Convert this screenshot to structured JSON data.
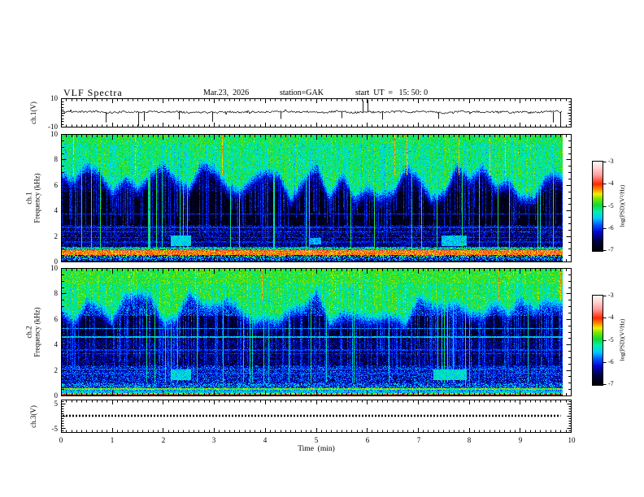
{
  "title": {
    "main": "VLF  Spectra",
    "date": "Mar.23,  2026",
    "station": "station=GAK",
    "start_ut": "start  UT  =   15: 50: 0"
  },
  "axes": {
    "x": {
      "label": "Time  (min)",
      "ticks": [
        "0",
        "1",
        "2",
        "3",
        "4",
        "5",
        "6",
        "7",
        "8",
        "9",
        "10"
      ],
      "min": 0,
      "max": 10
    },
    "ch1_wave": {
      "label": "ch.1(V)",
      "tick_top": "10",
      "tick_bottom": "-10",
      "min": -10,
      "max": 10
    },
    "ch1_freq": {
      "label_line1": "ch.1",
      "label_line2": "Frequency  (kHz)",
      "ticks": [
        "10",
        "8",
        "6",
        "4",
        "2",
        "0"
      ],
      "min": 0,
      "max": 10
    },
    "ch2_freq": {
      "label_line1": "ch.2",
      "label_line2": "Frequency  (kHz)",
      "ticks": [
        "10",
        "8",
        "6",
        "4",
        "2",
        "0"
      ],
      "min": 0,
      "max": 10
    },
    "ch3_wave": {
      "label": "ch.3(V)",
      "tick_top": "5",
      "tick_bottom": "-5",
      "min": -6.6,
      "max": 6.6
    }
  },
  "colorbar": {
    "label": "log(PSD)(V²/Hz)",
    "ticks": [
      "-3",
      "-4",
      "-5",
      "-6",
      "-7"
    ],
    "min": -7,
    "max": -3,
    "stops": [
      {
        "v": -7.0,
        "c": "#000000"
      },
      {
        "v": -6.55,
        "c": "#00004a"
      },
      {
        "v": -6.15,
        "c": "#0008d6"
      },
      {
        "v": -5.85,
        "c": "#0054ff"
      },
      {
        "v": -5.55,
        "c": "#00c8ff"
      },
      {
        "v": -5.25,
        "c": "#00f0b4"
      },
      {
        "v": -4.95,
        "c": "#10dc30"
      },
      {
        "v": -4.65,
        "c": "#7ce800"
      },
      {
        "v": -4.45,
        "c": "#f0f000"
      },
      {
        "v": -4.25,
        "c": "#ff9000"
      },
      {
        "v": -4.0,
        "c": "#ff2800"
      },
      {
        "v": -3.6,
        "c": "#ff9c9c"
      },
      {
        "v": -3.25,
        "c": "#ffd8d8"
      },
      {
        "v": -3.0,
        "c": "#fff2f2"
      }
    ]
  },
  "chart_data": [
    {
      "panel": "ch1_waveform",
      "type": "line",
      "x_range": [
        0,
        10
      ],
      "y_range": [
        -10,
        10
      ],
      "baseline": 0.35,
      "noise_amp": 1.4,
      "data_end_t": 9.84,
      "seed": 11,
      "spikes": [
        {
          "t": 0.88,
          "v": -7
        },
        {
          "t": 1.52,
          "v": -9.5
        },
        {
          "t": 1.62,
          "v": -6
        },
        {
          "t": 2.32,
          "v": -5
        },
        {
          "t": 2.96,
          "v": -6.5
        },
        {
          "t": 4.3,
          "v": -4.5
        },
        {
          "t": 5.5,
          "v": -4
        },
        {
          "t": 5.92,
          "v": 8.5
        },
        {
          "t": 6.02,
          "v": 9
        },
        {
          "t": 6.3,
          "v": -5
        },
        {
          "t": 7.4,
          "v": -4.5
        },
        {
          "t": 9.65,
          "v": -7
        },
        {
          "t": 9.8,
          "v": -9
        }
      ]
    },
    {
      "panel": "ch1_spectrogram",
      "type": "heatmap",
      "x_range": [
        0,
        10
      ],
      "f_range": [
        0,
        10
      ],
      "level_range": [
        -7,
        -3
      ],
      "data_end_t": 9.84,
      "seed": 42,
      "speckle": 0.22,
      "top": {
        "depth_base": 7.0,
        "depth_var": 1.6,
        "level": -5.15,
        "ramp": 1.5
      },
      "bands": [
        {
          "f0": 9.3,
          "f1": 10,
          "level": -5.1,
          "noise": 0.3
        },
        {
          "f0": 7.0,
          "f1": 9.3,
          "level": -6.1,
          "noise": 0.6
        },
        {
          "f0": 5.5,
          "f1": 7.0,
          "level": -6.6,
          "noise": 0.4
        },
        {
          "f0": 2.9,
          "f1": 5.5,
          "level": -6.85,
          "noise": 0.28
        },
        {
          "f0": 1.15,
          "f1": 2.9,
          "level": -6.45,
          "noise": 0.5
        },
        {
          "f0": 0.95,
          "f1": 1.15,
          "level": -5.7,
          "noise": 0.4
        },
        {
          "f0": 0.55,
          "f1": 0.95,
          "level": -4.15,
          "noise": 0.35
        },
        {
          "f0": 0.32,
          "f1": 0.55,
          "level": -5.8,
          "noise": 1.3
        },
        {
          "f0": 0.1,
          "f1": 0.32,
          "level": -5.9,
          "noise": 0.6
        },
        {
          "f0": 0.0,
          "f1": 0.1,
          "level": -6.9,
          "noise": 0.15
        }
      ],
      "hlines": [
        {
          "f": 3.75,
          "level": -6.05
        },
        {
          "f": 2.7,
          "level": -6.0
        },
        {
          "f": 2.35,
          "level": -6.0
        },
        {
          "f": 1.9,
          "level": -6.1
        },
        {
          "f": 1.55,
          "level": -6.1
        },
        {
          "f": 1.02,
          "level": -5.0
        }
      ],
      "patches": [
        {
          "t0": 2.15,
          "t1": 2.55,
          "f0": 1.25,
          "f1": 2.1,
          "level": -5.45
        },
        {
          "t0": 7.45,
          "t1": 7.95,
          "f0": 1.25,
          "f1": 2.05,
          "level": -5.5
        },
        {
          "t0": 4.85,
          "t1": 5.1,
          "f0": 1.35,
          "f1": 1.9,
          "level": -5.6
        }
      ],
      "streaks": {
        "strong_prob": 0.055,
        "strong_level": -5.25,
        "med_prob": 0.3,
        "med_level": -6.1,
        "med_min_f": 2.8,
        "orange_prob": 0.02,
        "orange_level": -4.35,
        "orange_min_f": 6.8
      }
    },
    {
      "panel": "ch2_spectrogram",
      "type": "heatmap",
      "x_range": [
        0,
        10
      ],
      "f_range": [
        0,
        10
      ],
      "level_range": [
        -7,
        -3
      ],
      "data_end_t": 9.84,
      "seed": 77,
      "speckle": 0.22,
      "top": {
        "depth_base": 7.5,
        "depth_var": 1.3,
        "level": -5.05,
        "ramp": 1.7
      },
      "bands": [
        {
          "f0": 8.8,
          "f1": 10,
          "level": -5.0,
          "noise": 0.3
        },
        {
          "f0": 6.3,
          "f1": 8.8,
          "level": -6.15,
          "noise": 0.6
        },
        {
          "f0": 4.4,
          "f1": 6.3,
          "level": -6.7,
          "noise": 0.32
        },
        {
          "f0": 2.4,
          "f1": 4.4,
          "level": -6.5,
          "noise": 0.42
        },
        {
          "f0": 1.0,
          "f1": 2.4,
          "level": -6.15,
          "noise": 0.5
        },
        {
          "f0": 0.62,
          "f1": 1.0,
          "level": -5.9,
          "noise": 0.55
        },
        {
          "f0": 0.5,
          "f1": 0.62,
          "level": -4.75,
          "noise": 0.3
        },
        {
          "f0": 0.36,
          "f1": 0.5,
          "level": -5.6,
          "noise": 0.4
        },
        {
          "f0": 0.22,
          "f1": 0.36,
          "level": -5.45,
          "noise": 0.4
        },
        {
          "f0": 0.08,
          "f1": 0.22,
          "level": -4.3,
          "noise": 0.3
        },
        {
          "f0": 0.0,
          "f1": 0.08,
          "level": -6.9,
          "noise": 0.1
        }
      ],
      "hlines": [
        {
          "f": 5.3,
          "level": -5.7
        },
        {
          "f": 4.6,
          "level": -5.55
        },
        {
          "f": 3.6,
          "level": -6.0
        },
        {
          "f": 3.3,
          "level": -6.05
        },
        {
          "f": 2.1,
          "level": -5.9
        },
        {
          "f": 1.75,
          "level": -6.0
        }
      ],
      "patches": [
        {
          "t0": 2.15,
          "t1": 2.55,
          "f0": 1.25,
          "f1": 2.1,
          "level": -5.45
        },
        {
          "t0": 7.3,
          "t1": 7.95,
          "f0": 1.25,
          "f1": 2.05,
          "level": -5.4
        }
      ],
      "streaks": {
        "strong_prob": 0.05,
        "strong_level": -5.3,
        "med_prob": 0.33,
        "med_level": -6.0,
        "med_min_f": 2.2,
        "orange_prob": 0.012,
        "orange_level": -4.3,
        "orange_min_f": 7.5
      }
    },
    {
      "panel": "ch3_waveform",
      "type": "line",
      "x_range": [
        0,
        10
      ],
      "y_range": [
        -6.6,
        6.6
      ],
      "value": 0,
      "style": "dotted",
      "data_end_t": 9.8,
      "line_width": 2.6
    }
  ]
}
